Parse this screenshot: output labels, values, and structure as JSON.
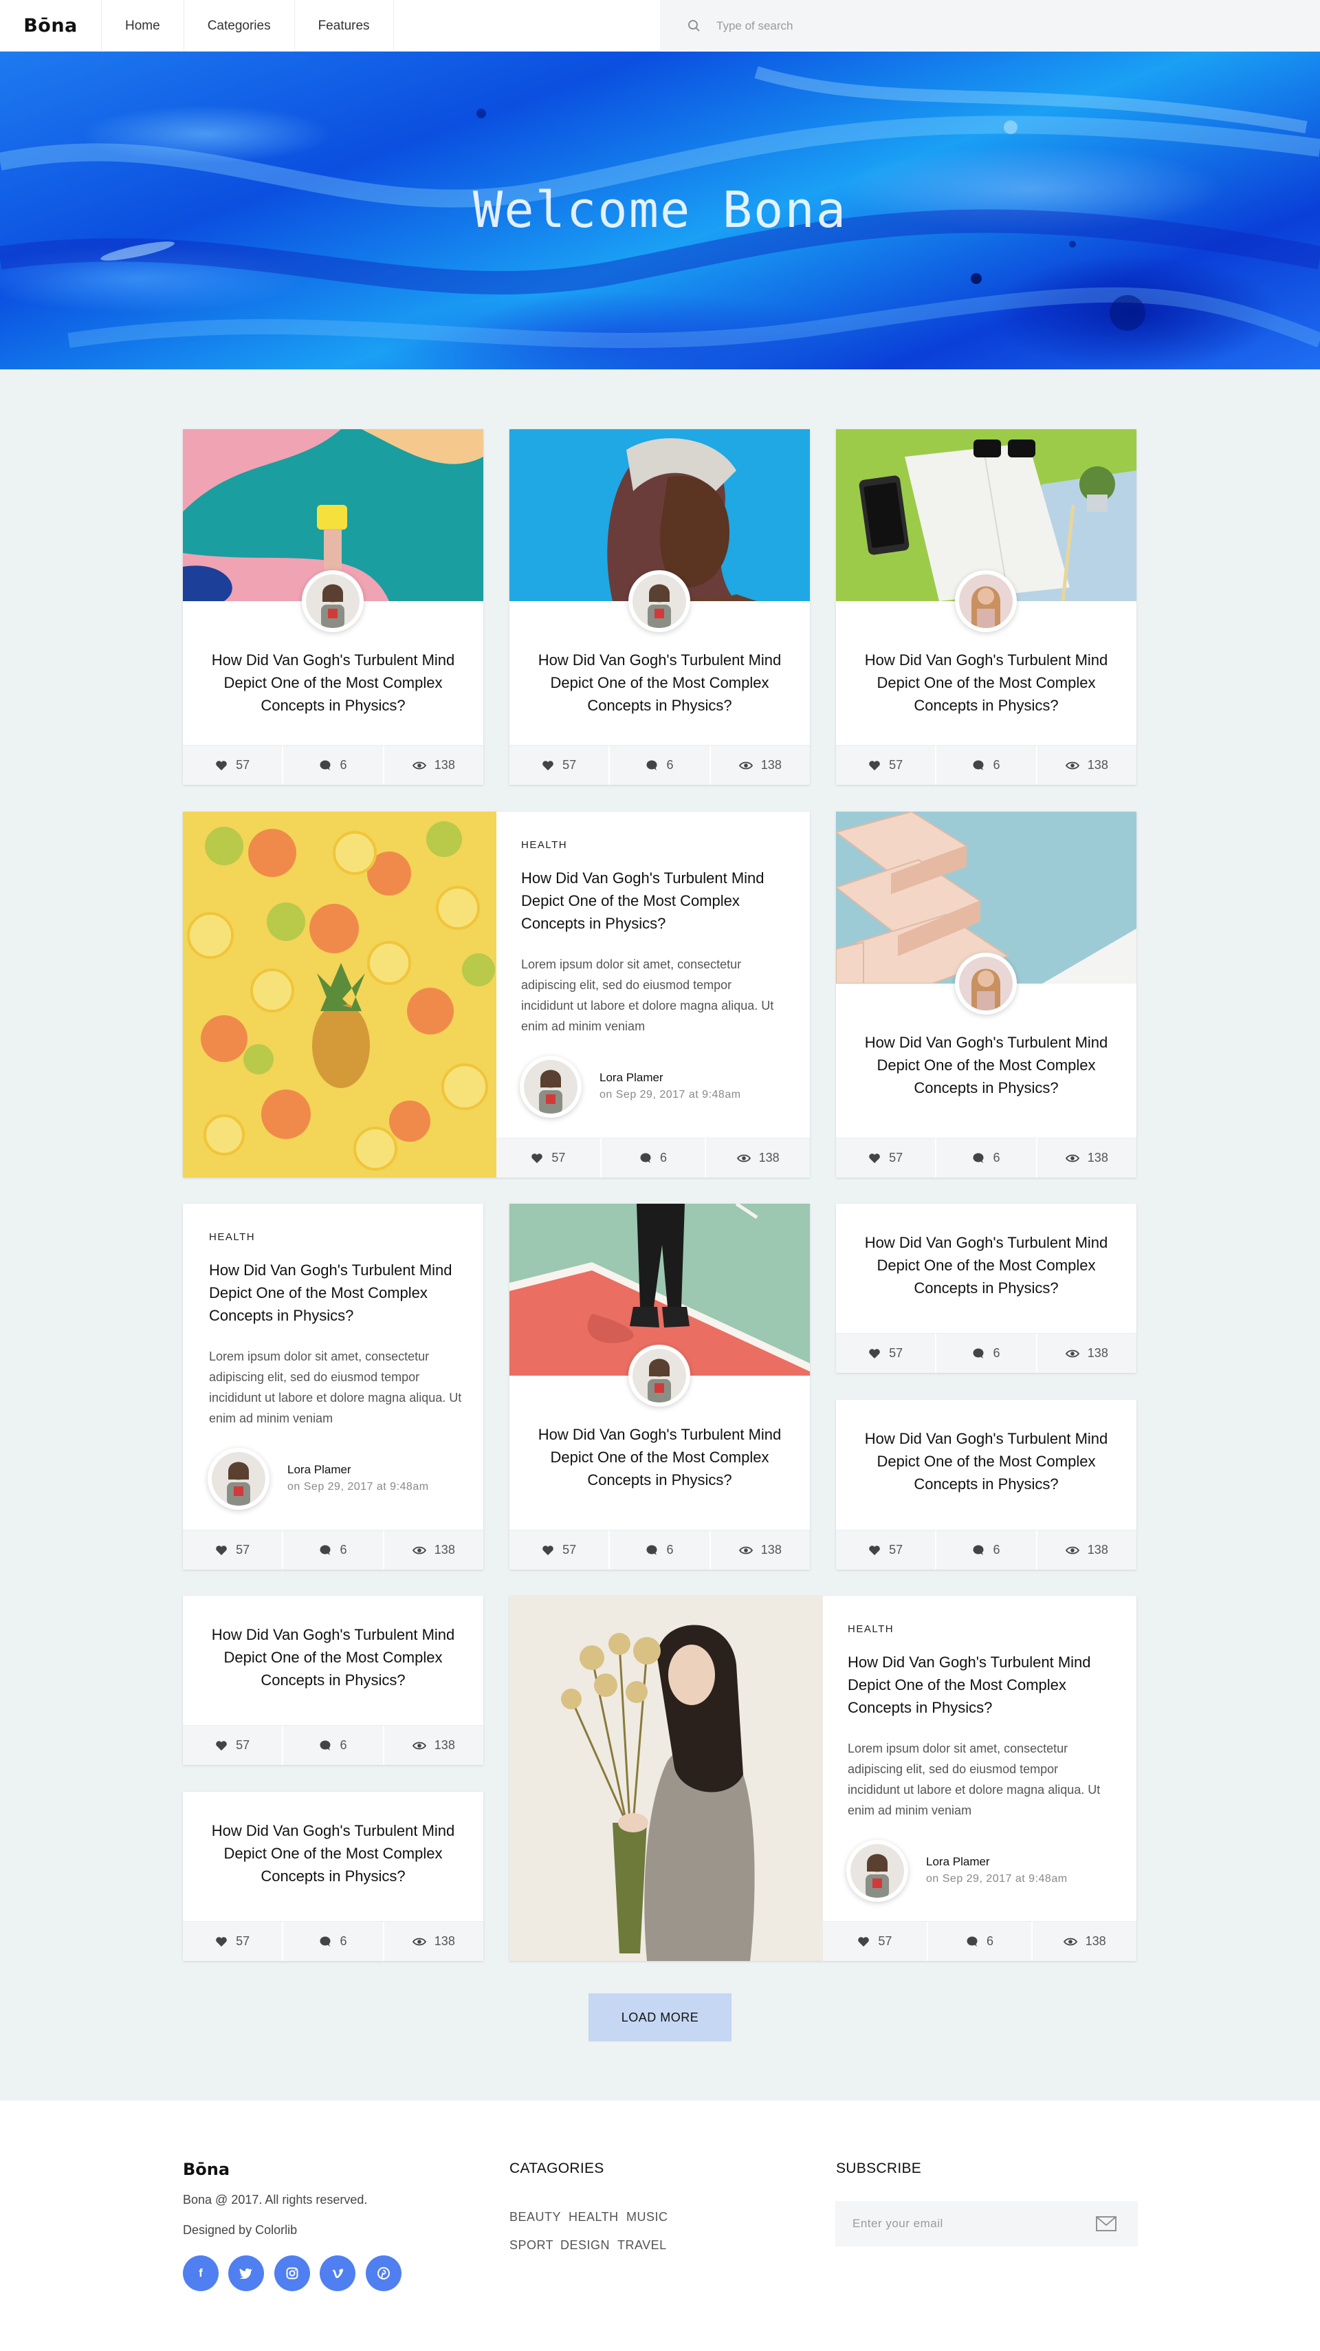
{
  "header": {
    "logo": "Bōna",
    "nav": [
      "Home",
      "Categories",
      "Features"
    ],
    "search_placeholder": "Type of search"
  },
  "hero": {
    "title": "Welcome Bona"
  },
  "colors": {
    "accent": "#4f7ff0",
    "page_bg": "#edf2f3",
    "load_more_bg": "#c5d7f2"
  },
  "posts": {
    "title": "How Did Van Gogh's Turbulent Mind Depict One of the Most Complex Concepts in Physics?",
    "category": "HEALTH",
    "excerpt": "Lorem ipsum dolor sit amet, consectetur adipiscing elit, sed do eiusmod tempor incididunt ut labore et dolore magna aliqua. Ut enim ad minim veniam",
    "author": "Lora Plamer",
    "date": "on Sep 29, 2017 at 9:48am",
    "likes": "57",
    "comments": "6",
    "views": "138"
  },
  "load_more": "LOAD MORE",
  "footer": {
    "logo": "Bōna",
    "copyright": "Bona @ 2017. All rights reserved.",
    "designed": "Designed by Colorlib",
    "social": [
      "facebook-icon",
      "twitter-icon",
      "instagram-icon",
      "vimeo-icon",
      "pinterest-icon"
    ],
    "categories_heading": "CATAGORIES",
    "categories": [
      "BEAUTY",
      "HEALTH",
      "MUSIC",
      "SPORT",
      "DESIGN",
      "TRAVEL"
    ],
    "subscribe_heading": "SUBSCRIBE",
    "email_placeholder": "Enter your email"
  }
}
